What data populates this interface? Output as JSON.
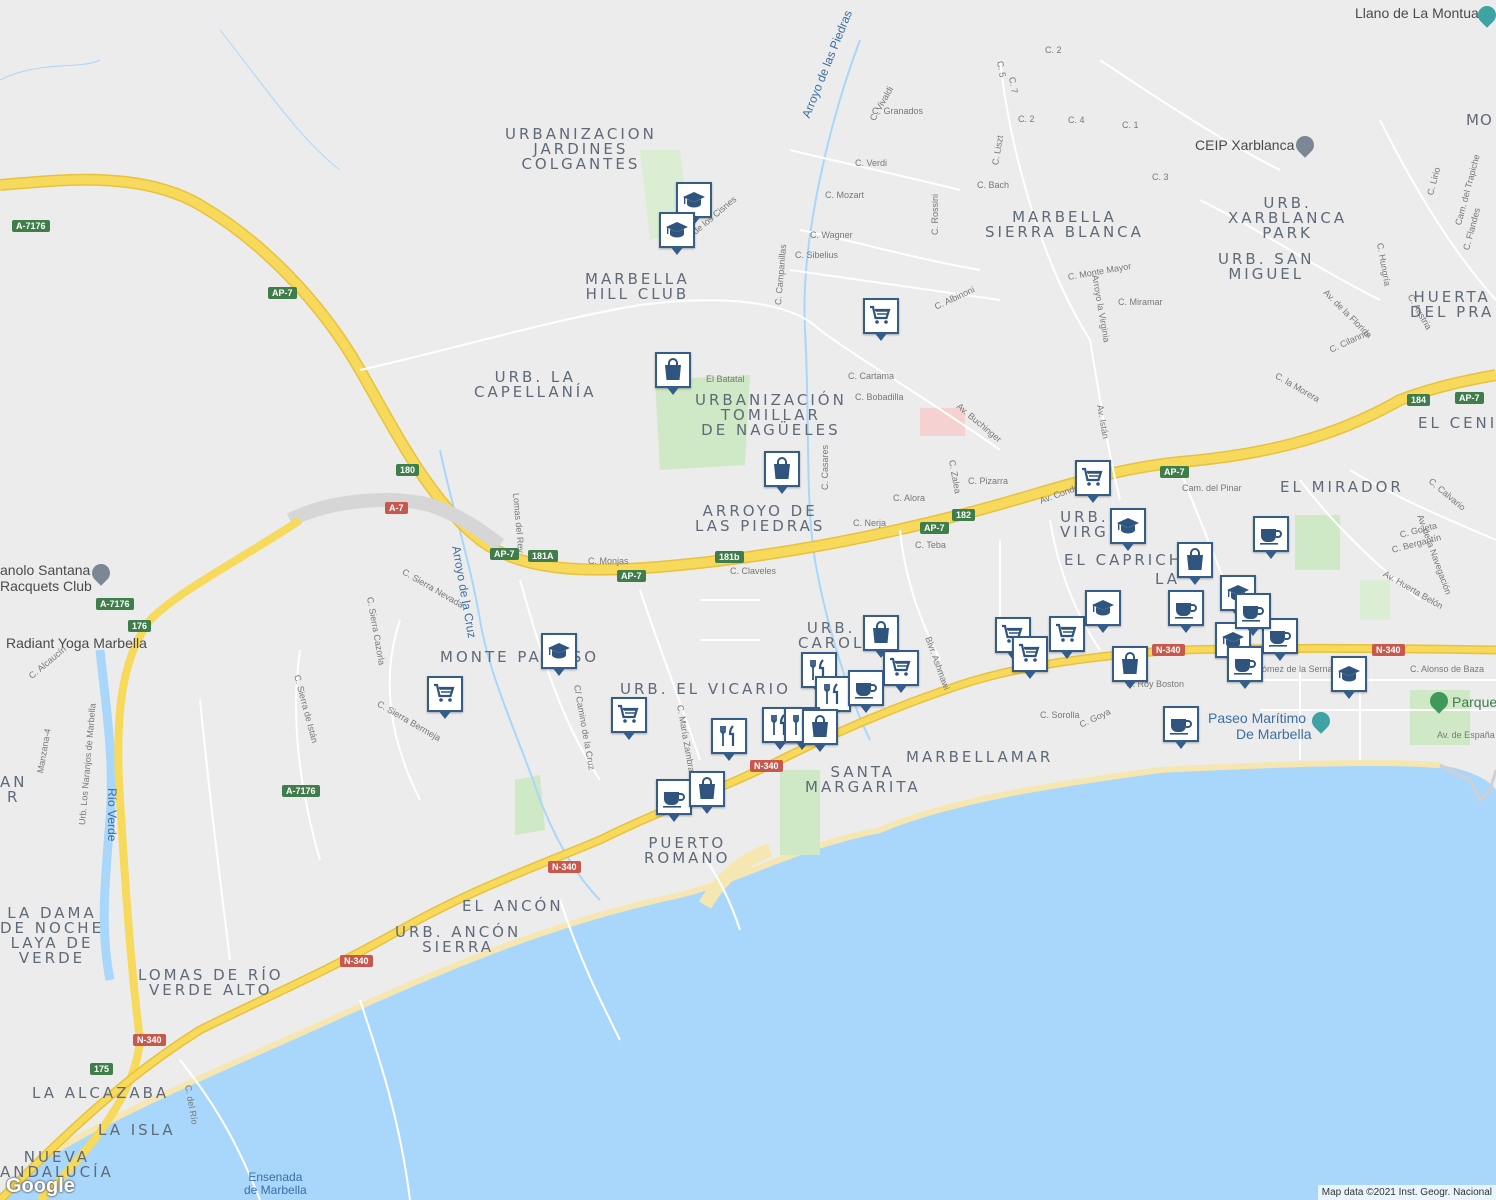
{
  "map": {
    "area_labels": [
      {
        "id": "jardines",
        "lines": [
          "URBANIZACION",
          "JARDINES",
          "COLGANTES"
        ]
      },
      {
        "id": "hillclub",
        "lines": [
          "MARBELLA",
          "HILL CLUB"
        ]
      },
      {
        "id": "capellania",
        "lines": [
          "URB. LA",
          "CAPELLANÍA"
        ]
      },
      {
        "id": "tomillar",
        "lines": [
          "URBANIZACIÓN",
          "TOMILLAR",
          "DE NAGÜELES"
        ]
      },
      {
        "id": "arroyo",
        "lines": [
          "ARROYO DE",
          "LAS PIEDRAS"
        ]
      },
      {
        "id": "sierrablanca",
        "lines": [
          "MARBELLA",
          "SIERRA BLANCA"
        ]
      },
      {
        "id": "xarblanca",
        "lines": [
          "URB.",
          "XARBLANCA",
          "PARK"
        ]
      },
      {
        "id": "sanmiguel",
        "lines": [
          "URB. SAN",
          "MIGUEL"
        ]
      },
      {
        "id": "huerta",
        "lines": [
          "HUERTA",
          "DEL PRA"
        ]
      },
      {
        "id": "cenit",
        "lines": [
          "EL CENIT"
        ]
      },
      {
        "id": "mirador",
        "lines": [
          "EL MIRADOR"
        ]
      },
      {
        "id": "virgen",
        "lines": [
          "URB.",
          "VIRG"
        ]
      },
      {
        "id": "capricho",
        "lines": [
          "EL CAPRICH"
        ]
      },
      {
        "id": "laleal",
        "lines": [
          "LA"
        ]
      },
      {
        "id": "montepa",
        "lines": [
          "MONTE PA",
          "SO"
        ]
      },
      {
        "id": "vicario",
        "lines": [
          "URB. EL VICARIO"
        ]
      },
      {
        "id": "carol",
        "lines": [
          "URB.",
          "CAROL"
        ]
      },
      {
        "id": "santamargarita",
        "lines": [
          "SANTA",
          "MARGARITA"
        ]
      },
      {
        "id": "marbellamar",
        "lines": [
          "MARBELLAMAR"
        ]
      },
      {
        "id": "puertoromano",
        "lines": [
          "PUERTO",
          "ROMANO"
        ]
      },
      {
        "id": "ancon",
        "lines": [
          "EL ANCÓN"
        ]
      },
      {
        "id": "anconsierra",
        "lines": [
          "URB. ANCÓN",
          "SIERRA"
        ]
      },
      {
        "id": "lomas",
        "lines": [
          "LOMAS DE RÍO",
          "VERDE ALTO"
        ]
      },
      {
        "id": "ladama",
        "lines": [
          "LA DAMA",
          "DE NOCHE",
          "LAYA DE",
          "VERDE"
        ]
      },
      {
        "id": "alcazaba",
        "lines": [
          "LA ALCAZABA"
        ]
      },
      {
        "id": "laisla",
        "lines": [
          "LA ISLA"
        ]
      },
      {
        "id": "nueva",
        "lines": [
          "NUEVA",
          "ANDALUCÍA"
        ]
      },
      {
        "id": "an",
        "lines": [
          "AN",
          "R"
        ]
      },
      {
        "id": "mo",
        "lines": [
          "Mo"
        ]
      }
    ],
    "poi_labels": {
      "llano": "Llano de La Montua",
      "ceip": "CEIP Xarblanca",
      "manolo": "anolo Santana",
      "racquets": "Racquets Club",
      "yoga": "Radiant Yoga Marbella",
      "paseo1": "Paseo Marítimo",
      "paseo2": "De Marbella",
      "parque": "Parque",
      "ensenada1": "Ensenada",
      "ensenada2": "de Marbella",
      "arroyo_piedras": "Arroyo de las Piedras",
      "arroyo_cruz": "Arroyo de la Cruz",
      "rio_verde": "Río Verde"
    },
    "streets": {
      "vivaldi": "C. Vivaldi",
      "granados": "C. Granados",
      "verdi": "C. Verdi",
      "bach": "C. Bach",
      "liszt": "C. Liszt",
      "mozart": "C. Mozart",
      "rossini": "C. Rossini",
      "wagner": "C. Wagner",
      "sibelius": "C. Sibelius",
      "albinoni": "C. Albinoni",
      "campanillas": "C. Campanillas",
      "losclsnes": "C. de los Cisnes",
      "batatal": "El Batatal",
      "cartama": "C. Cartama",
      "bobadilla": "C. Bobadilla",
      "buchinger": "Av. Buchinger",
      "casares": "C. Casares",
      "zalea": "C. Zalea",
      "pizarra": "C. Pizarra",
      "alora": "C. Alora",
      "nerja": "C. Nerja",
      "teba": "C. Teba",
      "monjas": "C. Monjas",
      "claveles": "C. Claveles",
      "montemayor": "C. Monte Mayor",
      "miramar": "C. Miramar",
      "virgenia": "Arroyo la Virginia",
      "avistan": "Av. Istán",
      "conde": "Av. Conde",
      "pinar": "Cam. del Pinar",
      "florida": "Av. de la Florida",
      "hungria": "C. Hungría",
      "austria": "C. Austria",
      "cilanno": "C. Cilanno",
      "morera": "C. la Morera",
      "trapiche": "Cam. del Trapiche",
      "calvario": "C. Calvario",
      "navegacion": "Av. de la Navegación",
      "goleta": "C. Goleta",
      "bergantin": "C. Bergantín",
      "huertabelon": "Av. Huerta Belón",
      "alonso": "C. Alonso de Baza",
      "gomez": "Gómez de la Serna",
      "espana": "Av. de España",
      "boston": "C. Roy Boston",
      "sorolla": "C. Sorolla",
      "goya": "C. Goya",
      "ashmawi": "Blvr. Ashmawi",
      "sierranevada": "C. Sierra Nevada",
      "cazorla": "C. Sierra Cazorla",
      "bermeja": "C. Sierra Bermeja",
      "camino": "C/ Camino de la Cruz",
      "zambrano": "C. María Zambrano",
      "istan": "C. Sierra de Istán",
      "lomasrey": "Lomas del Rey",
      "manzana": "Manzana-4",
      "naranjos": "Urb. Los Naranjos de Marbella",
      "alcaucin": "C. Alcaucín",
      "delrio": "C. del Río",
      "c2a": "C. 2",
      "c2b": "C. 2",
      "c4": "C. 4",
      "c1": "C. 1",
      "c3": "C. 3",
      "c5": "C. 5",
      "c7": "C. 7",
      "flandes": "C. Flandes",
      "lirio": "C. Lirio"
    },
    "shields": {
      "a7176a": "A-7176",
      "ap7a": "AP-7",
      "ap7b": "AP-7",
      "ap7c": "AP-7",
      "ap7d": "AP-7",
      "ap7e": "AP-7",
      "ap7f": "AP-7",
      "a7": "A-7",
      "s180": "180",
      "s181a": "181A",
      "s181b": "181b",
      "s182": "182",
      "s184": "184",
      "a7176b": "A-7176",
      "s176": "176",
      "a7176c": "A-7176",
      "n340a": "N-340",
      "n340b": "N-340",
      "n340c": "N-340",
      "n340d": "N-340",
      "n340e": "N-340",
      "s175": "175"
    },
    "markers": [
      {
        "type": "school",
        "icon": "graduation-cap-icon"
      },
      {
        "type": "school",
        "icon": "graduation-cap-icon"
      },
      {
        "type": "grocery",
        "icon": "shopping-cart-icon"
      },
      {
        "type": "shopping",
        "icon": "shopping-bag-icon"
      },
      {
        "type": "shopping",
        "icon": "shopping-bag-icon"
      },
      {
        "type": "grocery",
        "icon": "shopping-cart-icon"
      },
      {
        "type": "school",
        "icon": "graduation-cap-icon"
      },
      {
        "type": "cafe",
        "icon": "coffee-cup-icon"
      },
      {
        "type": "shopping",
        "icon": "shopping-bag-icon"
      },
      {
        "type": "school",
        "icon": "graduation-cap-icon"
      },
      {
        "type": "grocery",
        "icon": "shopping-cart-icon"
      },
      {
        "type": "grocery",
        "icon": "shopping-cart-icon"
      },
      {
        "type": "shopping",
        "icon": "shopping-bag-icon"
      },
      {
        "type": "restaurant",
        "icon": "fork-knife-icon"
      },
      {
        "type": "restaurant",
        "icon": "fork-knife-icon"
      },
      {
        "type": "restaurant",
        "icon": "fork-knife-icon"
      },
      {
        "type": "grocery",
        "icon": "shopping-cart-icon"
      },
      {
        "type": "restaurant",
        "icon": "fork-knife-icon"
      },
      {
        "type": "restaurant",
        "icon": "fork-knife-icon"
      },
      {
        "type": "shopping",
        "icon": "shopping-bag-icon"
      },
      {
        "type": "cafe",
        "icon": "coffee-cup-icon"
      },
      {
        "type": "shopping",
        "icon": "shopping-bag-icon"
      },
      {
        "type": "school",
        "icon": "graduation-cap-icon"
      },
      {
        "type": "grocery",
        "icon": "shopping-cart-icon"
      },
      {
        "type": "grocery",
        "icon": "shopping-cart-icon"
      },
      {
        "type": "grocery",
        "icon": "shopping-cart-icon"
      },
      {
        "type": "school",
        "icon": "graduation-cap-icon"
      },
      {
        "type": "shopping",
        "icon": "shopping-bag-icon"
      },
      {
        "type": "cafe",
        "icon": "coffee-cup-icon"
      },
      {
        "type": "cafe",
        "icon": "coffee-cup-icon"
      },
      {
        "type": "school",
        "icon": "graduation-cap-icon"
      },
      {
        "type": "cafe",
        "icon": "coffee-cup-icon"
      },
      {
        "type": "cafe",
        "icon": "coffee-cup-icon"
      },
      {
        "type": "school",
        "icon": "graduation-cap-icon"
      },
      {
        "type": "cafe",
        "icon": "coffee-cup-icon"
      },
      {
        "type": "cafe",
        "icon": "coffee-cup-icon"
      }
    ],
    "copyright": "Map data ©2021 Inst. Geogr. Nacional",
    "logo": "Google",
    "colors": {
      "land": "#ececec",
      "water": "#a9d7fb",
      "highway": "#f7d95b",
      "park": "#cfe8c6",
      "beach": "#f6e7b2",
      "marker_border": "#355d8a",
      "marker_icon": "#2f557f"
    }
  }
}
